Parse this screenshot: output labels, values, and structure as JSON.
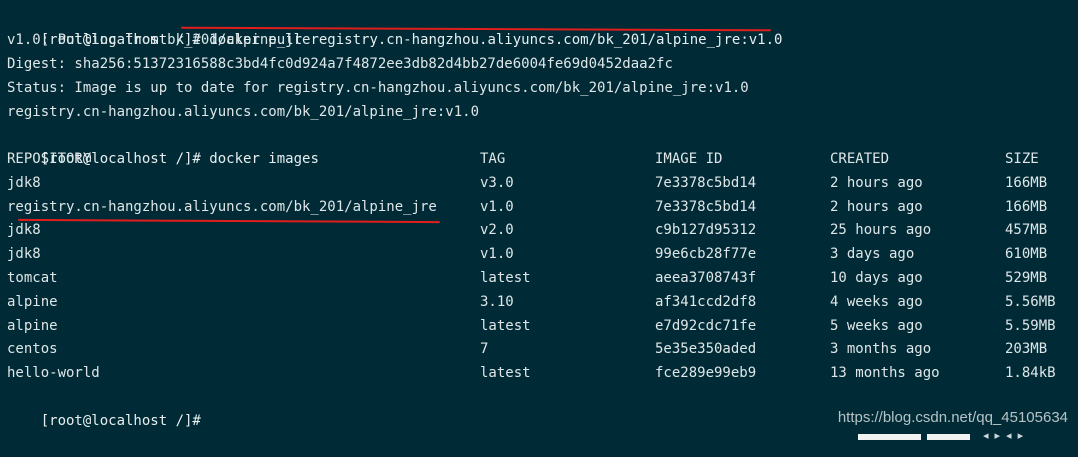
{
  "terminal": {
    "lines": [
      {
        "prompt": "[root@localhost /]#",
        "command": " docker pull registry.cn-hangzhou.aliyuncs.com/bk_201/alpine_jre:v1.0"
      },
      {
        "text": "v1.0: Pulling from bk_201/alpine_jre"
      },
      {
        "text": "Digest: sha256:51372316588c3bd4fc0d924a7f4872ee3db82d4bb27de6004fe69d0452daa2fc"
      },
      {
        "text": "Status: Image is up to date for registry.cn-hangzhou.aliyuncs.com/bk_201/alpine_jre:v1.0"
      },
      {
        "text": "registry.cn-hangzhou.aliyuncs.com/bk_201/alpine_jre:v1.0"
      },
      {
        "prompt": "[root@localhost /]#",
        "command": " docker images"
      }
    ],
    "table": {
      "headers": [
        "REPOSITORY",
        "TAG",
        "IMAGE ID",
        "CREATED",
        "SIZE"
      ],
      "rows": [
        [
          "jdk8",
          "v3.0",
          "7e3378c5bd14",
          "2 hours ago",
          "166MB"
        ],
        [
          "registry.cn-hangzhou.aliyuncs.com/bk_201/alpine_jre",
          "v1.0",
          "7e3378c5bd14",
          "2 hours ago",
          "166MB"
        ],
        [
          "jdk8",
          "v2.0",
          "c9b127d95312",
          "25 hours ago",
          "457MB"
        ],
        [
          "jdk8",
          "v1.0",
          "99e6cb28f77e",
          "3 days ago",
          "610MB"
        ],
        [
          "tomcat",
          "latest",
          "aeea3708743f",
          "10 days ago",
          "529MB"
        ],
        [
          "alpine",
          "3.10",
          "af341ccd2df8",
          "4 weeks ago",
          "5.56MB"
        ],
        [
          "alpine",
          "latest",
          "e7d92cdc71fe",
          "5 weeks ago",
          "5.59MB"
        ],
        [
          "centos",
          "7",
          "5e35e350aded",
          "3 months ago",
          "203MB"
        ],
        [
          "hello-world",
          "latest",
          "fce289e99eb9",
          "13 months ago",
          "1.84kB"
        ]
      ]
    },
    "final_prompt": "[root@localhost /]#"
  },
  "watermark": "https://blog.csdn.net/qq_45105634",
  "colors": {
    "background": "#002b36",
    "text": "#dfe6e8",
    "annotation": "#e01e1e"
  }
}
